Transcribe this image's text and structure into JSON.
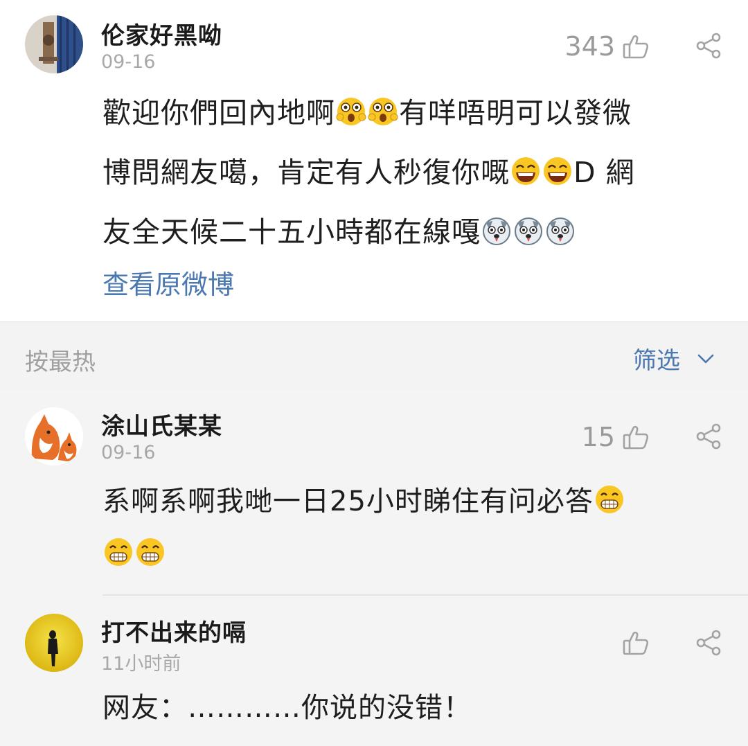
{
  "post": {
    "username": "伦家好黑呦",
    "date": "09-16",
    "likes": "343",
    "line1": "歡迎你們回內地啊",
    "line1b": "有咩唔明可以發微",
    "line2": "博問網友噶，肯定有人秒復你嘅",
    "line2b": "D 網",
    "line3": "友全天候二十五小時都在線嘎",
    "view_original": "查看原微博"
  },
  "sortbar": {
    "sort_label": "按最热",
    "filter_label": "筛选"
  },
  "comments": [
    {
      "username": "涂山氏某某",
      "date": "09-16",
      "likes": "15",
      "text": "系啊系啊我哋一日25小时睇住有问必答"
    },
    {
      "username": "打不出来的嗝",
      "date": "11小时前",
      "likes": "",
      "text": "网友：…………你说的没错！"
    }
  ],
  "icons": {
    "like": "thumbs-up-icon",
    "share": "share-icon",
    "filter_chevron": "chevron-down-icon"
  },
  "colors": {
    "link": "#4a78b0",
    "muted": "#a8a8a8",
    "background": "#f4f4f4"
  }
}
